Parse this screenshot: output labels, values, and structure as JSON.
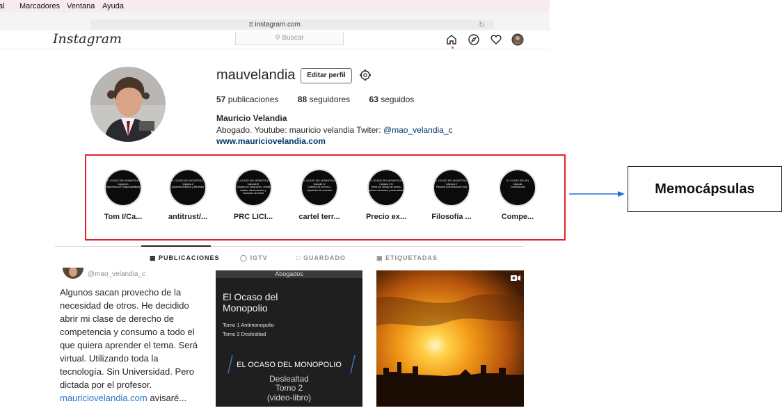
{
  "menubar": {
    "items": [
      "al",
      "Marcadores",
      "Ventana",
      "Ayuda"
    ]
  },
  "browser": {
    "url": "instagram.com"
  },
  "header": {
    "logo": "Instagram",
    "search_placeholder": "Buscar"
  },
  "profile": {
    "username": "mauvelandia",
    "edit_label": "Editar perfil",
    "posts_count": "57",
    "posts_label": "publicaciones",
    "followers_count": "88",
    "followers_label": "seguidores",
    "following_count": "63",
    "following_label": "seguidos",
    "full_name": "Mauricio Velandia",
    "bio_prefix": "Abogado. Youtube: mauricio velandia Twiter: ",
    "bio_handle": "@mao_velandia_c",
    "website": "www.mauriciovelandia.com"
  },
  "highlights": [
    {
      "label": "Tom I/Ca...",
      "cover": "EL OCASO DEL MONOPOLIO\nCápsula 1\nAlgoritmos de Responsabilidad"
    },
    {
      "label": "antitrust/...",
      "cover": "EL OCASO DEL MONOPOLIO\nCápsula 2\nAcuerdos Antitrust y Bienestar"
    },
    {
      "label": "PRC LICI...",
      "cover": "EL OCASO DEL MONOPOLIO\nCápsula III\nColusión en licitaciones, ventas atadas, discriminación y reducción de oferta"
    },
    {
      "label": "cartel terr...",
      "cover": "EL OCASO DEL MONOPOLIO\nCápsula IV\nCarteles de precios y repartición de mercado"
    },
    {
      "label": "Precio ex...",
      "cover": "EL OCASO DEL MONOPOLIO\nCápsula XXI\nVenta por debajo de costos, precios excesivos y venta atada"
    },
    {
      "label": "Filosofía ...",
      "cover": "EL OCASO DEL MONOPOLIO\nCápsula V\nFilosofía económica de unos"
    },
    {
      "label": "Compe...",
      "cover": "EL OCASO DEL MO\nCápsula\nCompetencia"
    }
  ],
  "callout": {
    "label": "Memocápsulas"
  },
  "tabs": [
    {
      "label": "PUBLICACIONES",
      "icon": "grid-icon",
      "active": true
    },
    {
      "label": "IGTV",
      "icon": "igtv-icon",
      "active": false
    },
    {
      "label": "GUARDADO",
      "icon": "bookmark-icon",
      "active": false
    },
    {
      "label": "ETIQUETADAS",
      "icon": "tag-icon",
      "active": false
    }
  ],
  "posts": {
    "p1_handle": "@mao_velandia_c",
    "p1_text": "Algunos sacan provecho de la necesidad de otros. He decidido abrir mi clase de derecho de competencia y consumo a todo el que quiera aprender el tema. Será virtual. Utilizando toda la tecnología. Sin Universidad. Pero dictada por el profesor. ",
    "p1_link": "mauriciovelandia.com",
    "p1_more": " avisaré...",
    "p2_top": "Abogados",
    "p2_title": "El Ocaso del Monopolio",
    "p2_line1": "Tomo 1 Antimonopolio",
    "p2_line2": "Tomo 2 Deslealtad",
    "p2_banner": "EL OCASO DEL MONOPOLIO",
    "p2_sub1": "Deslealtad",
    "p2_sub2": "Tomo 2",
    "p2_sub3": "(video-libro)"
  },
  "colors": {
    "highlight_box": "#e0212b",
    "arrow": "#1e6fd9",
    "link": "#00376b"
  }
}
